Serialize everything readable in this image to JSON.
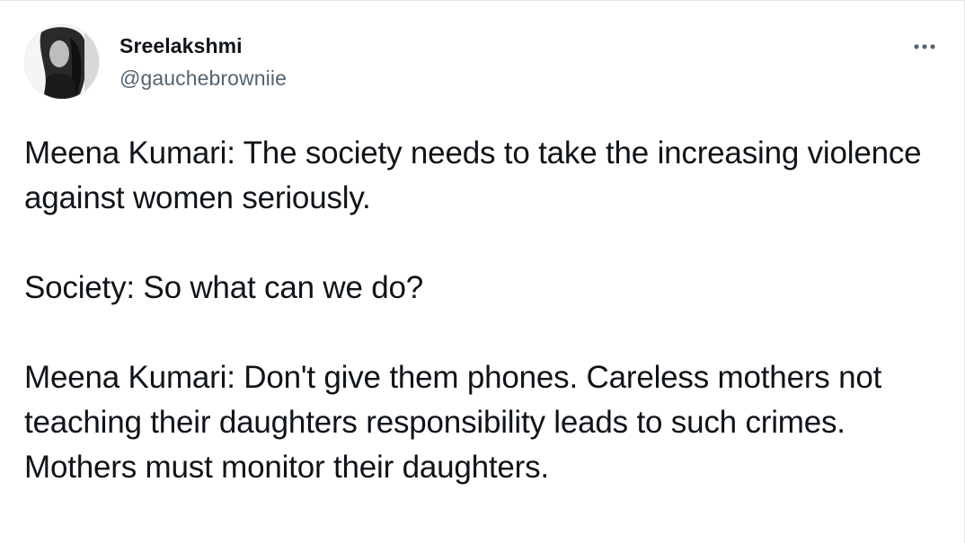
{
  "author": {
    "display_name": "Sreelakshmi",
    "handle": "@gauchebrowniie"
  },
  "menu": {
    "icon": "more-horizontal-icon"
  },
  "tweet": {
    "paragraphs": [
      "Meena Kumari: The society needs to take the increasing violence against women seriously.",
      "Society: So what can we do?",
      "Meena Kumari: Don't give them phones. Careless mothers not teaching their daughters responsibility leads to such crimes. Mothers must monitor their daughters."
    ]
  },
  "colors": {
    "text": "#0f1419",
    "secondary_text": "#536471",
    "background": "#ffffff"
  }
}
